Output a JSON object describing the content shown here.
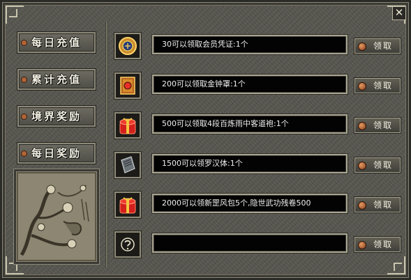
{
  "window": {
    "close_label": "✕"
  },
  "nav": [
    {
      "label": "每日充值"
    },
    {
      "label": "累计充值"
    },
    {
      "label": "境界奖励"
    },
    {
      "label": "每日奖励"
    }
  ],
  "rewards": [
    {
      "icon": "seal-medallion-icon",
      "text": "30可以领取会员凭证:1个",
      "button": "领取"
    },
    {
      "icon": "golden-bell-book-icon",
      "text": "200可以领取金钟罩:1个",
      "button": "领取"
    },
    {
      "icon": "red-gift-box-icon",
      "text": "500可以领取4段百炼雨中客道袍:1个",
      "button": "领取"
    },
    {
      "icon": "gray-scroll-book-icon",
      "text": "1500可以领罗汉体:1个",
      "button": "领取"
    },
    {
      "icon": "red-gift-box-icon",
      "text": "2000可以领新罡风包5个,隐世武功残卷500",
      "button": "领取"
    },
    {
      "icon": "question-mark-icon",
      "text": "",
      "button": "领取"
    }
  ]
}
